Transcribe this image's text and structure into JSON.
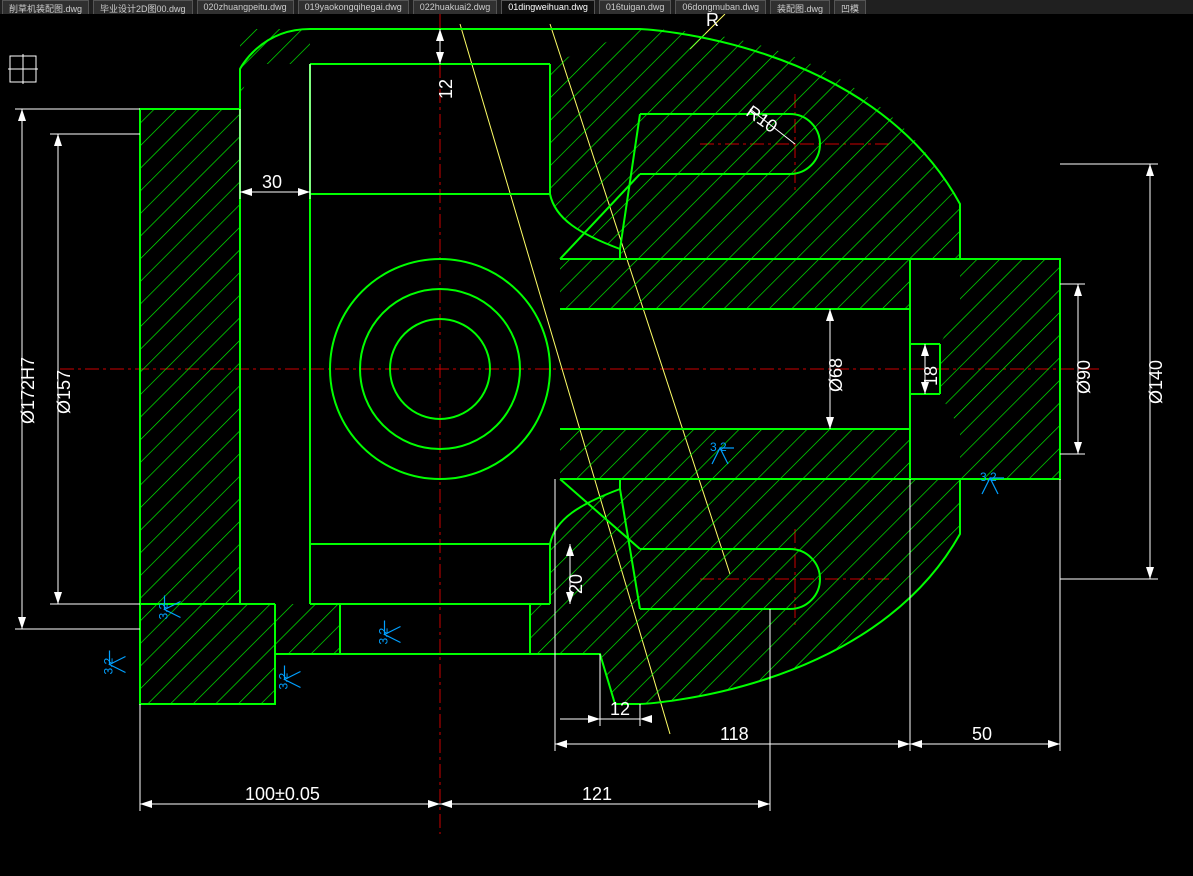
{
  "tabs": [
    {
      "label": "削草机装配图.dwg"
    },
    {
      "label": "毕业设计2D图00.dwg"
    },
    {
      "label": "020zhuangpeitu.dwg"
    },
    {
      "label": "019yaokongqihegai.dwg"
    },
    {
      "label": "022huakuai2.dwg"
    },
    {
      "label": "01dingweihuan.dwg"
    },
    {
      "label": "016tuigan.dwg"
    },
    {
      "label": "06dongmuban.dwg"
    },
    {
      "label": "装配图.dwg"
    },
    {
      "label": "凹模"
    }
  ],
  "active_tab_index": 5,
  "dimensions": {
    "d172h7": "Ø172H7",
    "d157": "Ø157",
    "d68": "Ø68",
    "d90": "Ø90",
    "d140": "Ø140",
    "h12a": "12",
    "h12b": "12",
    "h20": "20",
    "h18": "18",
    "h30": "30",
    "r10": "R10",
    "r_arc": "R",
    "w100": "100±0.05",
    "w121": "121",
    "w118": "118",
    "w50": "50"
  },
  "surface_finish": "3.2"
}
